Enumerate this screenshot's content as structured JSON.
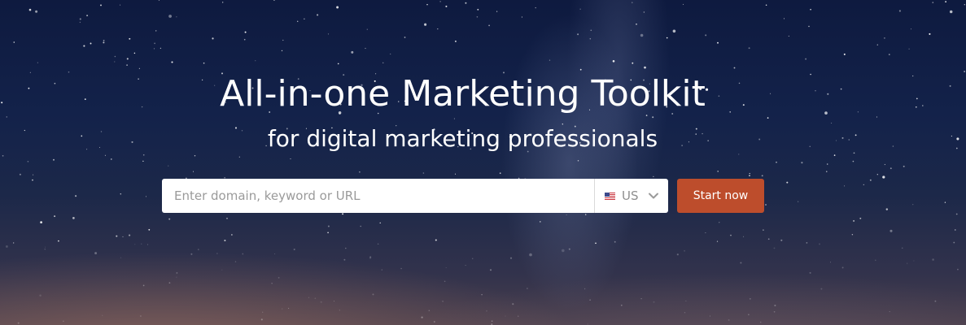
{
  "hero": {
    "title": "All-in-one Marketing Toolkit",
    "subtitle": "for digital marketing professionals"
  },
  "search": {
    "placeholder": "Enter domain, keyword or URL",
    "value": ""
  },
  "database_select": {
    "flag_icon": "us-flag-icon",
    "selected": "US",
    "chevron_icon": "chevron-down-icon"
  },
  "cta": {
    "label": "Start now"
  },
  "colors": {
    "accent": "#bd4d2c",
    "background_top": "#0e1a3f",
    "background_bottom": "#4a3f4d"
  }
}
